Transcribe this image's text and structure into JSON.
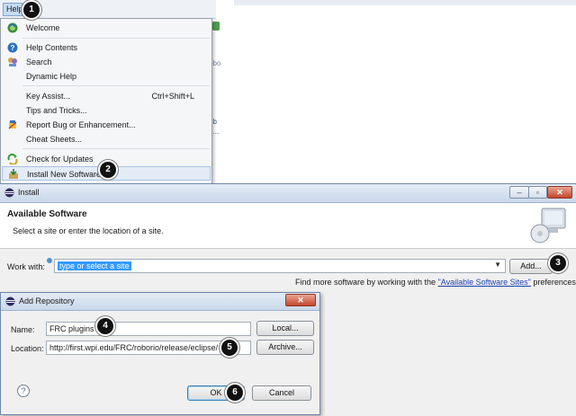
{
  "background": {
    "fragments": [
      "obo",
      "ob",
      "e..."
    ]
  },
  "help_menu": {
    "menubar_label": "Help",
    "items": [
      {
        "label": "Welcome",
        "shortcut": "",
        "icon": "welcome-globe-icon"
      },
      {
        "label": "Help Contents",
        "shortcut": "",
        "icon": "help-circle-icon"
      },
      {
        "label": "Search",
        "shortcut": "",
        "icon": "search-people-icon"
      },
      {
        "label": "Dynamic Help",
        "shortcut": "",
        "icon": ""
      },
      {
        "label": "Key Assist...",
        "shortcut": "Ctrl+Shift+L",
        "icon": ""
      },
      {
        "label": "Tips and Tricks...",
        "shortcut": "",
        "icon": ""
      },
      {
        "label": "Report Bug or Enhancement...",
        "shortcut": "",
        "icon": "bug-report-icon"
      },
      {
        "label": "Cheat Sheets...",
        "shortcut": "",
        "icon": ""
      },
      {
        "label": "Check for Updates",
        "shortcut": "",
        "icon": "update-arrows-icon"
      },
      {
        "label": "Install New Software...",
        "shortcut": "",
        "icon": "install-software-icon"
      }
    ]
  },
  "callouts": [
    "1",
    "2",
    "3",
    "4",
    "5",
    "6"
  ],
  "install": {
    "window_title": "Install",
    "header_title": "Available Software",
    "header_subtitle": "Select a site or enter the location of a site.",
    "work_with_label": "Work with:",
    "work_with_value": "type or select a site",
    "add_button": "Add...",
    "find_more_prefix": "Find more software by working with the ",
    "find_more_link": "\"Available Software Sites\"",
    "find_more_suffix": " preferences."
  },
  "add_repository": {
    "title": "Add Repository",
    "name_label": "Name:",
    "name_value": "FRC plugins",
    "location_label": "Location:",
    "location_value": "http://first.wpi.edu/FRC/roborio/release/eclipse/",
    "local_button": "Local...",
    "archive_button": "Archive...",
    "help_symbol": "?",
    "ok_button": "OK",
    "cancel_button": "Cancel"
  },
  "colors": {
    "selection": "#3399ff",
    "link": "#1c3fb0",
    "callout": "#111111"
  }
}
